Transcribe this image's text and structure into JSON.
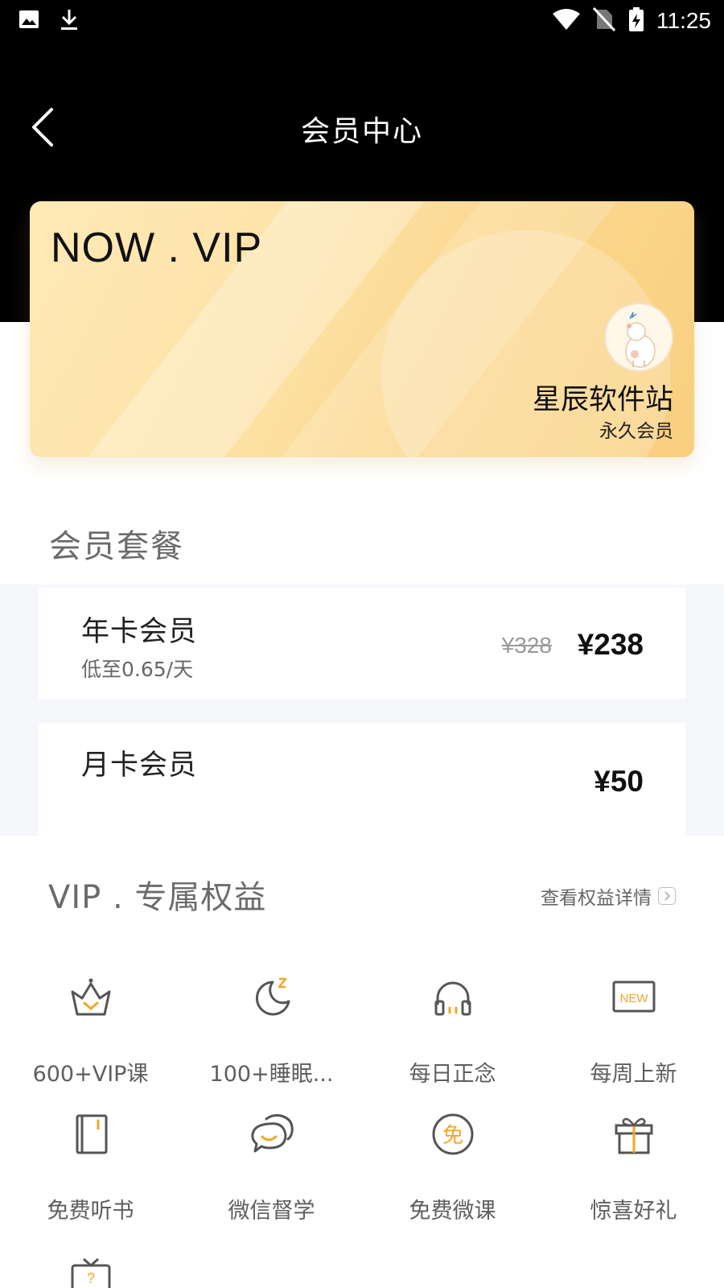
{
  "status_bar": {
    "time": "11:25",
    "left_icons": [
      "image-icon",
      "download-icon"
    ],
    "right_icons": [
      "wifi-icon",
      "no-sim-icon",
      "battery-charging-icon"
    ]
  },
  "nav": {
    "title": "会员中心",
    "back_icon": "back-arrow-icon"
  },
  "vip_card": {
    "title": "NOW . VIP",
    "user_name": "星辰软件站",
    "member_level": "永久会员",
    "avatar_icon": "polar-bear-avatar"
  },
  "plans": {
    "section_title": "会员套餐",
    "items": [
      {
        "name": "年卡会员",
        "subtitle": "低至0.65/天",
        "original_price": "¥328",
        "price": "¥238"
      },
      {
        "name": "月卡会员",
        "subtitle": "",
        "original_price": "",
        "price": "¥50"
      }
    ]
  },
  "benefits": {
    "section_title": "VIP . 专属权益",
    "details_link": "查看权益详情",
    "items": [
      {
        "label": "600+VIP课",
        "icon": "crown-icon"
      },
      {
        "label": "100+睡眠...",
        "icon": "moon-sleep-icon"
      },
      {
        "label": "每日正念",
        "icon": "headphones-icon"
      },
      {
        "label": "每周上新",
        "icon": "new-badge-icon"
      },
      {
        "label": "免费听书",
        "icon": "book-icon"
      },
      {
        "label": "微信督学",
        "icon": "chat-bubbles-icon"
      },
      {
        "label": "免费微课",
        "icon": "free-coin-icon"
      },
      {
        "label": "惊喜好礼",
        "icon": "gift-icon"
      },
      {
        "label": "",
        "icon": "tv-question-icon"
      }
    ]
  },
  "colors": {
    "accent": "#f5a623",
    "header_bg": "#000000",
    "card_gold": "#fcd890"
  }
}
